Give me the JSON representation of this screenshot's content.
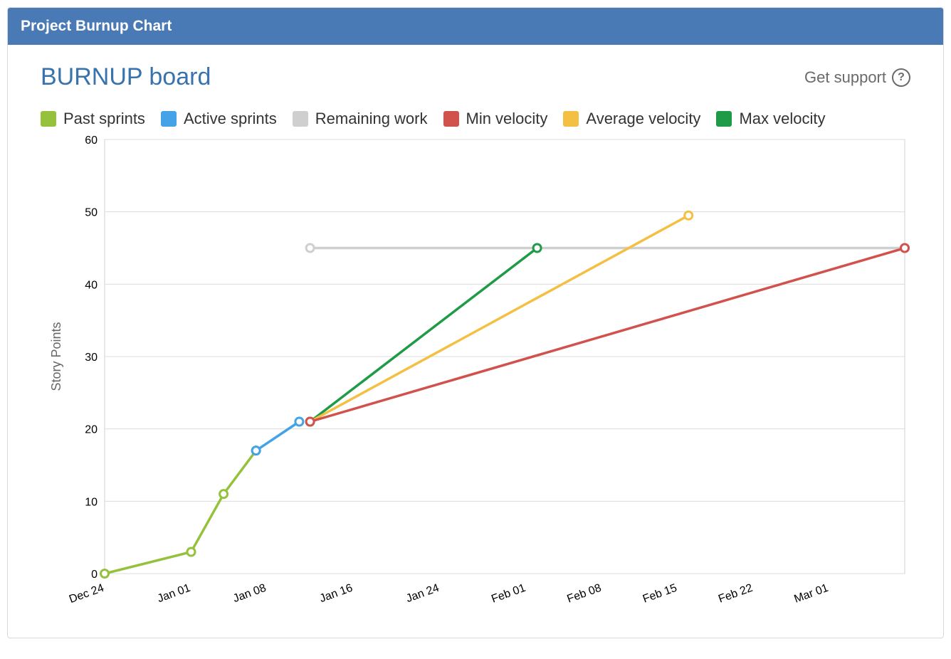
{
  "panel": {
    "title": "Project Burnup Chart"
  },
  "header": {
    "board_title": "BURNUP board",
    "support_label": "Get support",
    "support_tooltip": "?"
  },
  "legend": [
    {
      "label": "Past sprints",
      "color": "#95c13d"
    },
    {
      "label": "Active sprints",
      "color": "#43a3e6"
    },
    {
      "label": "Remaining work",
      "color": "#cfcfcf"
    },
    {
      "label": "Min velocity",
      "color": "#d1524c"
    },
    {
      "label": "Average velocity",
      "color": "#f3c043"
    },
    {
      "label": "Max velocity",
      "color": "#1f9a46"
    }
  ],
  "chart_data": {
    "type": "line",
    "title": "",
    "xlabel": "",
    "ylabel": "Story Points",
    "ylim": [
      0,
      60
    ],
    "x_ticks": [
      "Dec 24",
      "Jan 01",
      "Jan 08",
      "Jan 16",
      "Jan 24",
      "Feb 01",
      "Feb 08",
      "Feb 15",
      "Feb 22",
      "Mar 01"
    ],
    "y_ticks": [
      0,
      10,
      20,
      30,
      40,
      50,
      60
    ],
    "x_domain_days": [
      0,
      74
    ],
    "x_tick_days": [
      0,
      8,
      15,
      23,
      31,
      39,
      46,
      53,
      60,
      67
    ],
    "series": [
      {
        "name": "Past sprints",
        "color": "#95c13d",
        "points": [
          {
            "day": 0,
            "y": 0
          },
          {
            "day": 8,
            "y": 3
          },
          {
            "day": 11,
            "y": 11
          },
          {
            "day": 14,
            "y": 17
          }
        ]
      },
      {
        "name": "Active sprints",
        "color": "#43a3e6",
        "points": [
          {
            "day": 14,
            "y": 17
          },
          {
            "day": 18,
            "y": 21
          }
        ]
      },
      {
        "name": "Remaining work",
        "color": "#cfcfcf",
        "points": [
          {
            "day": 19,
            "y": 45
          },
          {
            "day": 74,
            "y": 45
          }
        ]
      },
      {
        "name": "Max velocity",
        "color": "#1f9a46",
        "points": [
          {
            "day": 19,
            "y": 21
          },
          {
            "day": 40,
            "y": 45
          }
        ]
      },
      {
        "name": "Average velocity",
        "color": "#f3c043",
        "points": [
          {
            "day": 19,
            "y": 21
          },
          {
            "day": 54,
            "y": 49.5
          }
        ]
      },
      {
        "name": "Min velocity",
        "color": "#d1524c",
        "points": [
          {
            "day": 19,
            "y": 21
          },
          {
            "day": 74,
            "y": 45
          }
        ]
      }
    ]
  }
}
